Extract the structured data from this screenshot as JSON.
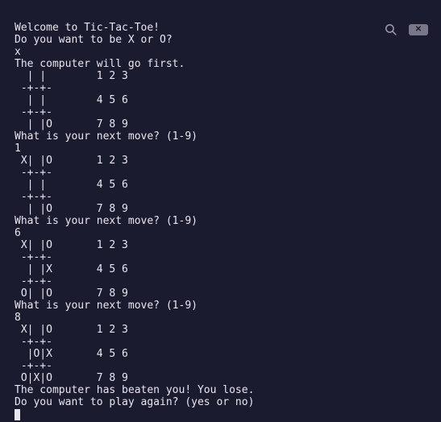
{
  "terminal": {
    "lines": [
      "Welcome to Tic-Tac-Toe!",
      "Do you want to be X or O?",
      "x",
      "The computer will go first.",
      "  | |        1 2 3",
      " -+-+-",
      "  | |        4 5 6",
      " -+-+-",
      "  | |O       7 8 9",
      "What is your next move? (1-9)",
      "1",
      " X| |O       1 2 3",
      " -+-+-",
      "  | |        4 5 6",
      " -+-+-",
      "  | |O       7 8 9",
      "What is your next move? (1-9)",
      "6",
      " X| |O       1 2 3",
      " -+-+-",
      "  | |X       4 5 6",
      " -+-+-",
      " O| |O       7 8 9",
      "What is your next move? (1-9)",
      "8",
      " X| |O       1 2 3",
      " -+-+-",
      "  |O|X       4 5 6",
      " -+-+-",
      " O|X|O       7 8 9",
      "The computer has beaten you! You lose.",
      "Do you want to play again? (yes or no)"
    ]
  },
  "icons": {
    "search": "search-icon",
    "clear": "clear-icon"
  }
}
